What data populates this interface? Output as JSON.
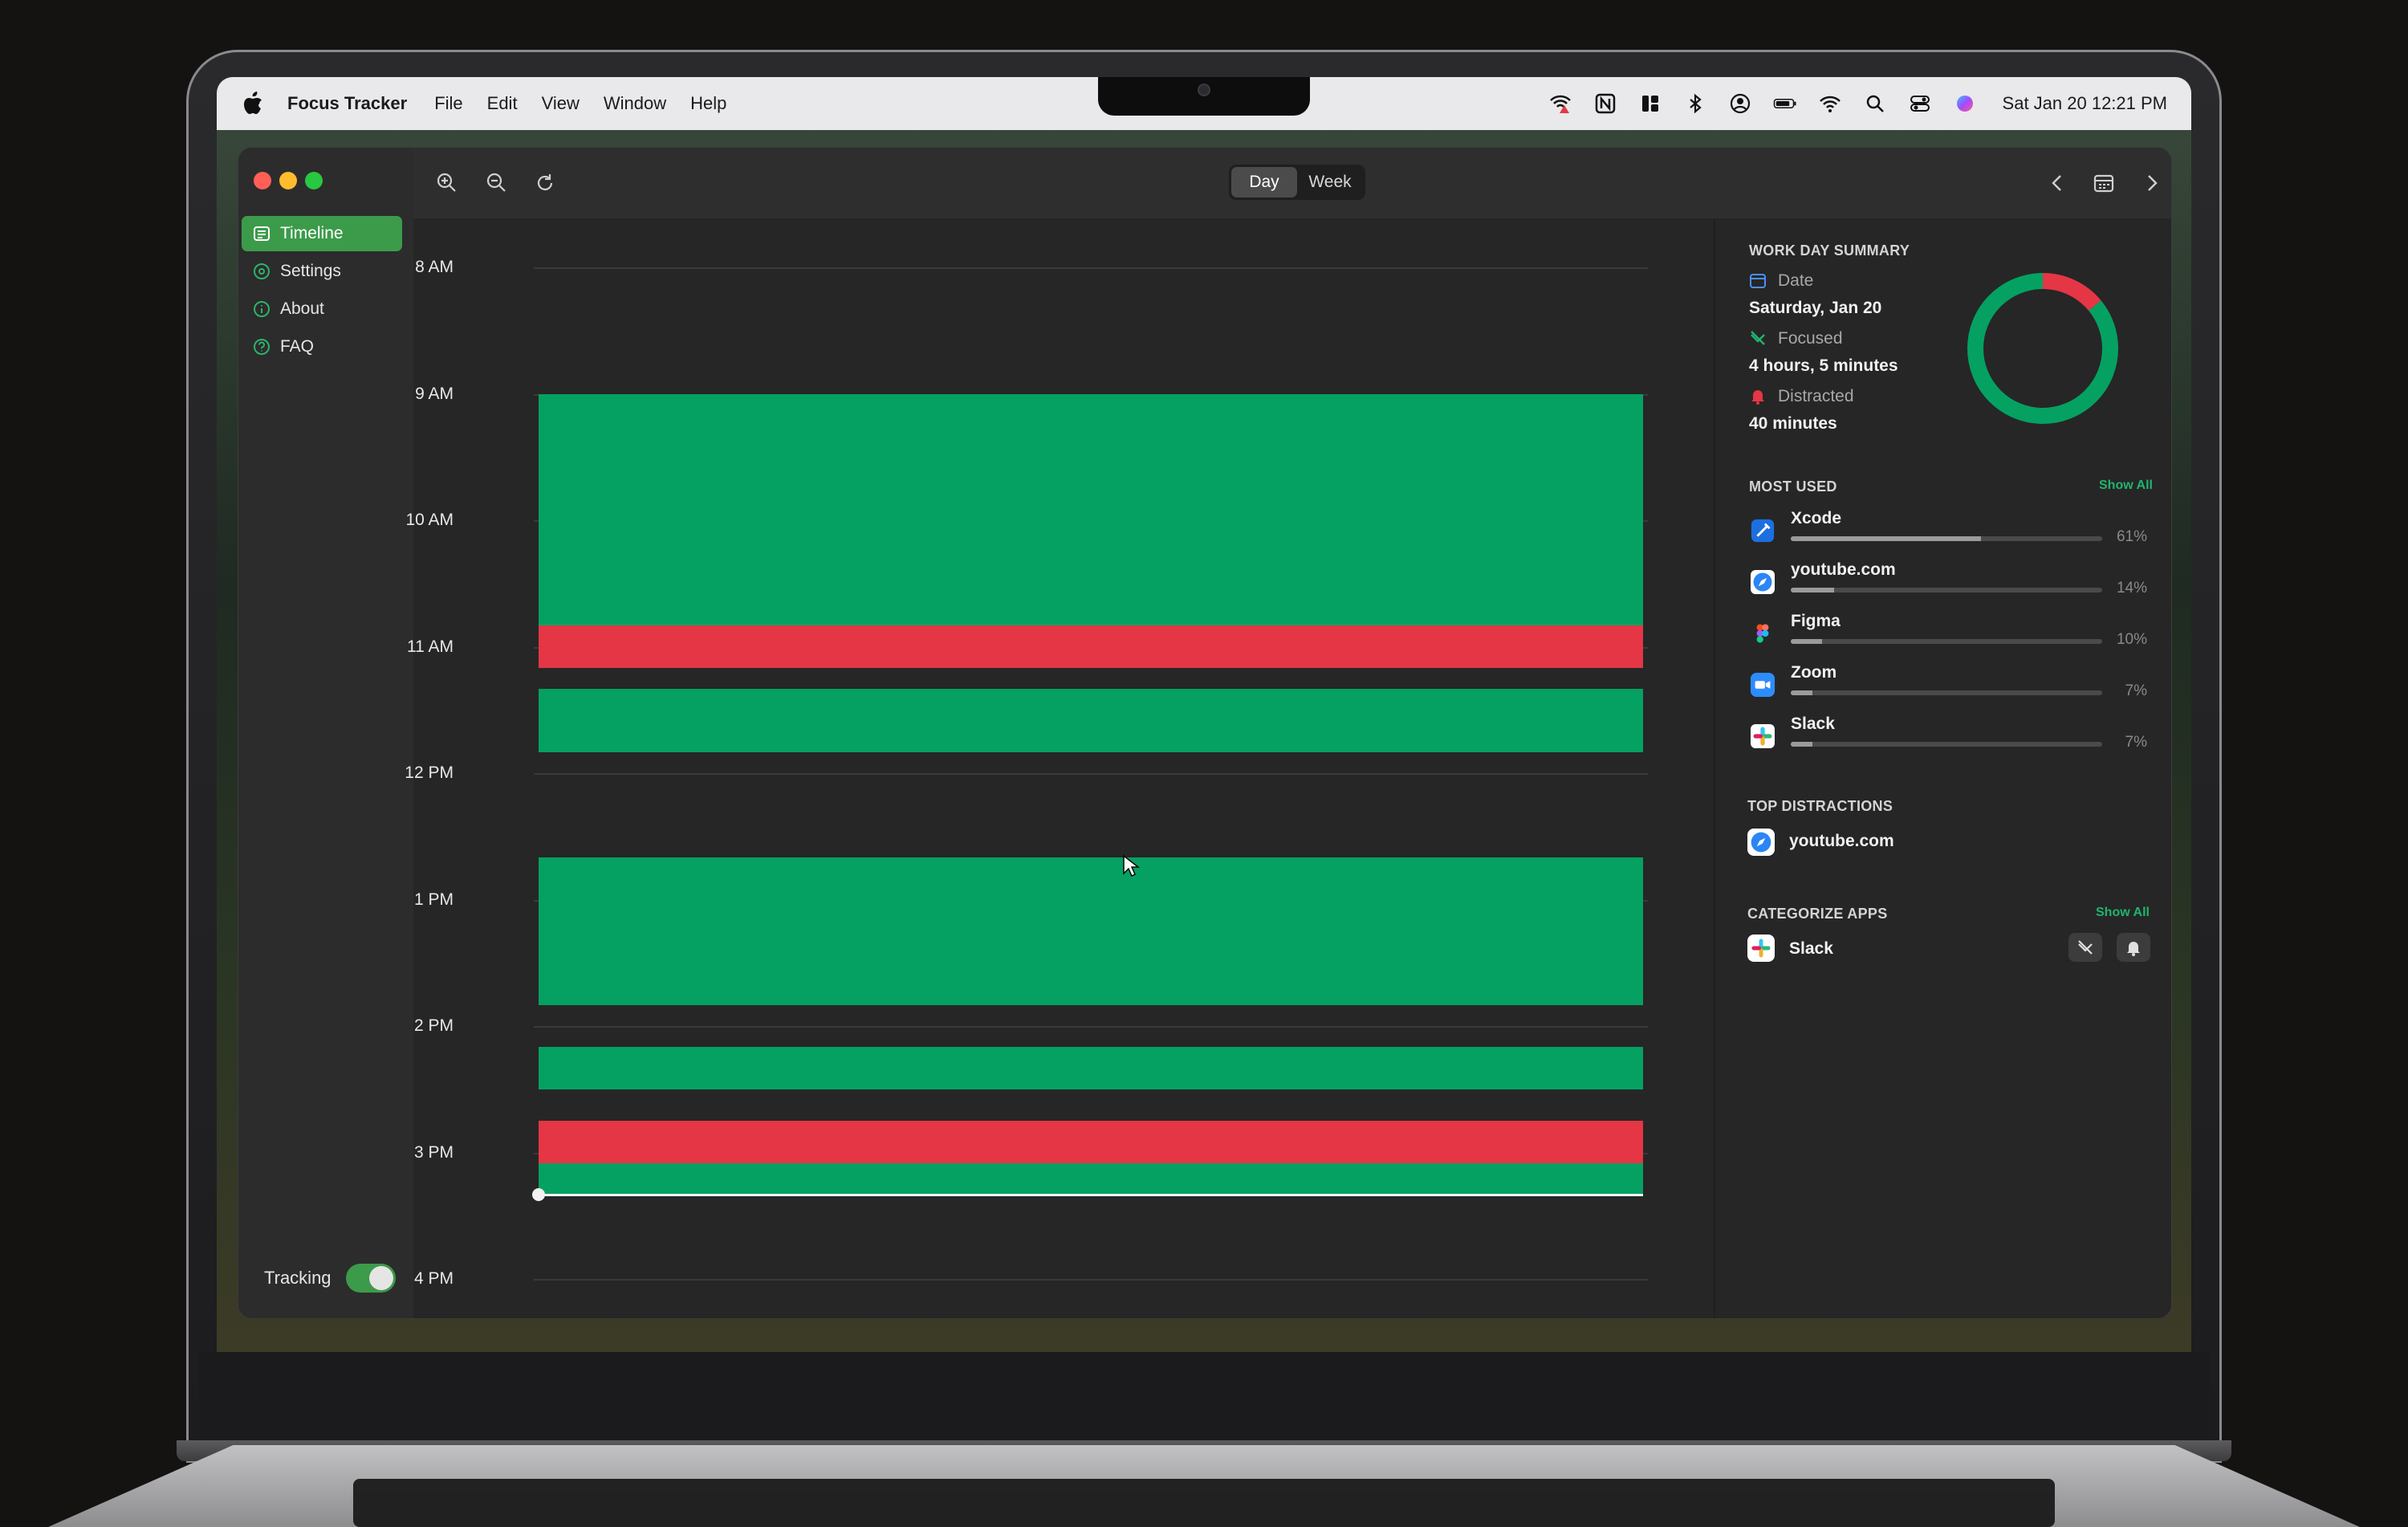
{
  "menubar": {
    "app_name": "Focus Tracker",
    "items": [
      "File",
      "Edit",
      "View",
      "Window",
      "Help"
    ],
    "status_icons": [
      "wifi-warning-icon",
      "notion-icon",
      "grid-icon",
      "bluetooth-icon",
      "user-icon",
      "battery-icon",
      "wifi-icon",
      "search-icon",
      "control-center-icon",
      "siri-icon"
    ],
    "clock": "Sat Jan 20  12:21 PM"
  },
  "sidebar": {
    "items": [
      {
        "label": "Timeline",
        "icon": "timeline-icon",
        "active": true
      },
      {
        "label": "Settings",
        "icon": "gear-icon",
        "active": false
      },
      {
        "label": "About",
        "icon": "info-icon",
        "active": false
      },
      {
        "label": "FAQ",
        "icon": "question-icon",
        "active": false
      }
    ],
    "tracking_label": "Tracking",
    "tracking_on": true
  },
  "toolbar": {
    "view_options": [
      "Day",
      "Week"
    ],
    "selected_view": "Day"
  },
  "timeline": {
    "hours": [
      "8 AM",
      "9 AM",
      "10 AM",
      "11 AM",
      "12 PM",
      "1 PM",
      "2 PM",
      "3 PM",
      "4 PM"
    ],
    "blocks": [
      {
        "type": "focused",
        "start": "9:00",
        "end": "10:50"
      },
      {
        "type": "distracted",
        "start": "10:50",
        "end": "11:10"
      },
      {
        "type": "focused",
        "start": "11:20",
        "end": "11:50"
      },
      {
        "type": "focused",
        "start": "12:40",
        "end": "13:50"
      },
      {
        "type": "focused",
        "start": "14:10",
        "end": "14:30"
      },
      {
        "type": "distracted",
        "start": "14:45",
        "end": "15:05"
      },
      {
        "type": "focused",
        "start": "15:05",
        "end": "15:20"
      }
    ],
    "colors": {
      "focused": "#05a162",
      "distracted": "#e53645"
    }
  },
  "summary": {
    "title": "WORK DAY SUMMARY",
    "date_label": "Date",
    "date_value": "Saturday, Jan 20",
    "focused_label": "Focused",
    "focused_value": "4 hours, 5 minutes",
    "distracted_label": "Distracted",
    "distracted_value": "40 minutes",
    "focused_minutes": 245,
    "distracted_minutes": 40
  },
  "most_used": {
    "title": "MOST USED",
    "show_all": "Show All",
    "apps": [
      {
        "name": "Xcode",
        "percent": 61,
        "pct_label": "61%",
        "icon": "xcode-icon"
      },
      {
        "name": "youtube.com",
        "percent": 14,
        "pct_label": "14%",
        "icon": "safari-icon"
      },
      {
        "name": "Figma",
        "percent": 10,
        "pct_label": "10%",
        "icon": "figma-icon"
      },
      {
        "name": "Zoom",
        "percent": 7,
        "pct_label": "7%",
        "icon": "zoom-icon"
      },
      {
        "name": "Slack",
        "percent": 7,
        "pct_label": "7%",
        "icon": "slack-icon"
      }
    ]
  },
  "top_distractions": {
    "title": "TOP DISTRACTIONS",
    "items": [
      {
        "name": "youtube.com",
        "icon": "safari-icon"
      }
    ]
  },
  "categorize": {
    "title": "CATEGORIZE APPS",
    "show_all": "Show All",
    "items": [
      {
        "name": "Slack",
        "icon": "slack-icon"
      }
    ]
  }
}
